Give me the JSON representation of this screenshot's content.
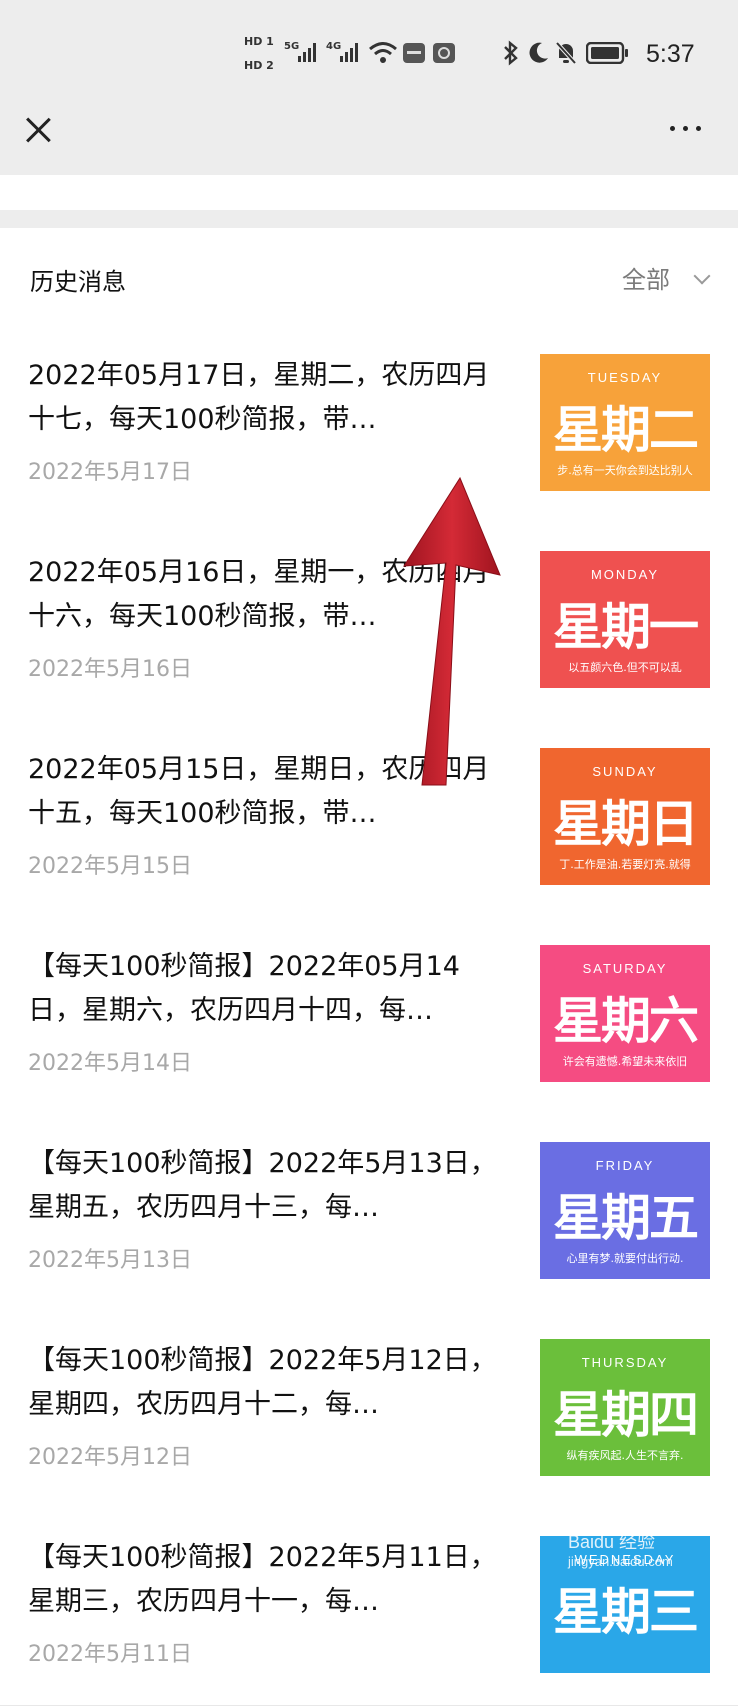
{
  "status_bar": {
    "hd1": "HD 1",
    "hd2": "HD 2",
    "net1": "5G",
    "net2": "4G",
    "time": "5:37"
  },
  "nav": {
    "close_icon": "close-icon",
    "more_icon": "more-icon"
  },
  "history": {
    "title": "历史消息",
    "filter_label": "全部"
  },
  "items": [
    {
      "title": "2022年05月17日，星期二，农历四月十七，每天100秒简报，带…",
      "date": "2022年5月17日",
      "thumb_en": "TUESDAY",
      "thumb_day": "星期二",
      "thumb_sub": "步.总有一天你会到达比别人",
      "color": "#f7a23a"
    },
    {
      "title": "2022年05月16日，星期一，农历四月十六，每天100秒简报，带…",
      "date": "2022年5月16日",
      "thumb_en": "MONDAY",
      "thumb_day": "星期一",
      "thumb_sub": "以五颜六色.但不可以乱",
      "color": "#ef5150"
    },
    {
      "title": "2022年05月15日，星期日，农历四月十五，每天100秒简报，带…",
      "date": "2022年5月15日",
      "thumb_en": "SUNDAY",
      "thumb_day": "星期日",
      "thumb_sub": "丁.工作是油.若要灯亮.就得",
      "color": "#f0662f"
    },
    {
      "title": "【每天100秒简报】2022年05月14日，星期六，农历四月十四，每…",
      "date": "2022年5月14日",
      "thumb_en": "SATURDAY",
      "thumb_day": "星期六",
      "thumb_sub": "许会有遗憾.希望未来依旧",
      "color": "#f54c82"
    },
    {
      "title": "【每天100秒简报】2022年5月13日，星期五，农历四月十三，每…",
      "date": "2022年5月13日",
      "thumb_en": "FRIDAY",
      "thumb_day": "星期五",
      "thumb_sub": "心里有梦.就要付出行动.",
      "color": "#6a6ee3"
    },
    {
      "title": "【每天100秒简报】2022年5月12日，星期四，农历四月十二，每…",
      "date": "2022年5月12日",
      "thumb_en": "THURSDAY",
      "thumb_day": "星期四",
      "thumb_sub": "纵有疾风起.人生不言弃.",
      "color": "#6bbf3b"
    },
    {
      "title": "【每天100秒简报】2022年5月11日，星期三，农历四月十一，每…",
      "date": "2022年5月11日",
      "thumb_en": "WEDNESDAY",
      "thumb_day": "星期三",
      "thumb_sub": "",
      "color": "#2aa7e8"
    }
  ],
  "watermark": {
    "line1": "Baidu 经验",
    "line2": "jingyan.baidu.com"
  },
  "colors": {
    "topbar": "#ededed",
    "arrow": "#c8202c"
  }
}
